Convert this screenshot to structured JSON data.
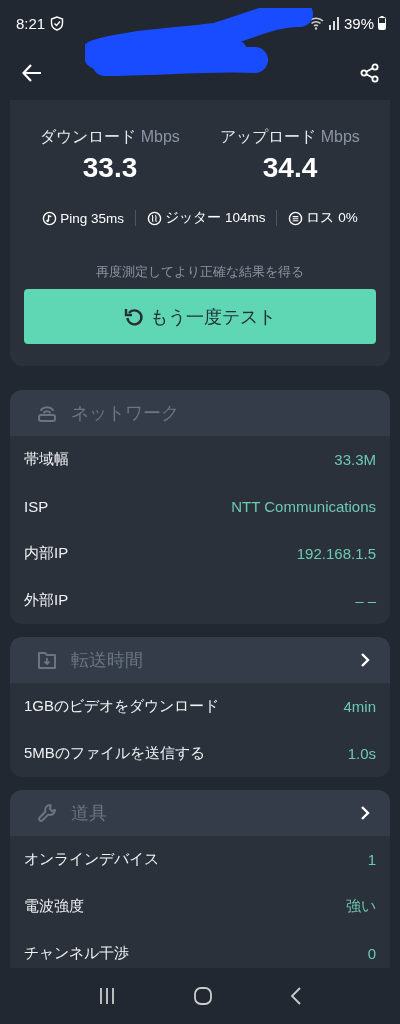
{
  "status_bar": {
    "time": "8:21",
    "battery": "39%"
  },
  "speed": {
    "download": {
      "label": "ダウンロード",
      "unit": "Mbps",
      "value": "33.3"
    },
    "upload": {
      "label": "アップロード",
      "unit": "Mbps",
      "value": "34.4"
    }
  },
  "stats": [
    {
      "kind": "ping",
      "text": "Ping 35ms"
    },
    {
      "kind": "jitter",
      "text": "ジッター 104ms"
    },
    {
      "kind": "loss",
      "text": "ロス 0%"
    }
  ],
  "hint": "再度測定してより正確な結果を得る",
  "retest_button": "もう一度テスト",
  "sections": [
    {
      "kind": "network",
      "title": "ネットワーク",
      "chevron": false,
      "rows": [
        {
          "label": "帯域幅",
          "value": "33.3M"
        },
        {
          "label": "ISP",
          "value": "NTT Communications"
        },
        {
          "label": "内部IP",
          "value": "192.168.1.5"
        },
        {
          "label": "外部IP",
          "value": "– –"
        }
      ]
    },
    {
      "kind": "transfer",
      "title": "転送時間",
      "chevron": true,
      "rows": [
        {
          "label": "1GBのビデオをダウンロード",
          "value": "4min"
        },
        {
          "label": "5MBのファイルを送信する",
          "value": "1.0s"
        }
      ]
    },
    {
      "kind": "tools",
      "title": "道具",
      "chevron": true,
      "rows": [
        {
          "label": "オンラインデバイス",
          "value": "1"
        },
        {
          "label": "電波強度",
          "value": "強い"
        },
        {
          "label": "チャンネル干渉",
          "value": "0"
        }
      ]
    }
  ]
}
